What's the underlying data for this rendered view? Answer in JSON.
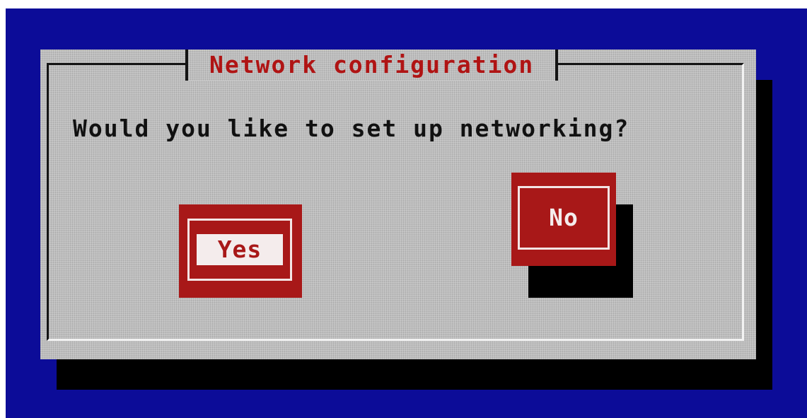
{
  "dialog": {
    "title": "Network configuration",
    "prompt": "Would you like to set up networking?",
    "buttons": {
      "yes_label": "Yes",
      "no_label": "No"
    },
    "focused_button": "Yes"
  },
  "colors": {
    "screen_background": "#0c0c98",
    "dialog_background": "#bdbdbd",
    "title_text": "#b01414",
    "button_background": "#a81818",
    "button_focus_text": "#a81818",
    "button_text": "#f4ecec",
    "shadow": "#000000"
  }
}
